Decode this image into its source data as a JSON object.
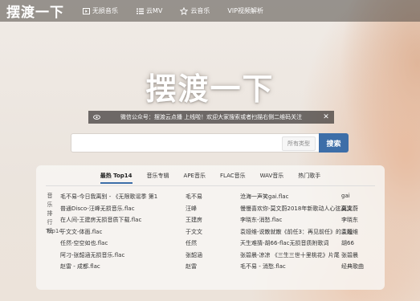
{
  "header": {
    "logo": "摆渡一下",
    "nav": [
      {
        "label": "无损音乐",
        "icon": "video-icon"
      },
      {
        "label": "云MV",
        "icon": "list-icon"
      },
      {
        "label": "云音乐",
        "icon": "star-icon"
      },
      {
        "label": "VIP视频解析",
        "icon": ""
      }
    ]
  },
  "hero": {
    "title": "摆渡一下"
  },
  "notice": {
    "text": "微信公众号：摆渡云点播 上线啦！欢迎大家搜索或者扫描右侧二维码关注"
  },
  "search": {
    "value": "",
    "type_label": "所有类型",
    "button": "搜索"
  },
  "tabs": [
    "最热 Top14",
    "音乐专辑",
    "APE音乐",
    "FLAC音乐",
    "WAV音乐",
    "热门歌手"
  ],
  "side_label": {
    "chars": [
      "音",
      "乐",
      "排",
      "行",
      "榜"
    ],
    "latin": "Top14"
  },
  "rows": [
    [
      "毛不易-今日我离别 - 《无限歌谣季 第1",
      "毛不易",
      "沧海一声笑gai.flac",
      "gai"
    ],
    [
      "普通Disco-汪峰无损音乐.flac",
      "汪峰",
      "慢慢喜欢你-莫文蔚2018年新歌动人心弦高清",
      "莫文蔚"
    ],
    [
      "在人间-王建房无损音质下载.flac",
      "王建房",
      "李晓东-消愁.flac",
      "李晓东"
    ],
    [
      "于文文-体面.flac",
      "于文文",
      "袁娅维-说散就散《前任3：再见前任》的主题",
      "袁娅维"
    ],
    [
      "任然-空空如也.flac",
      "任然",
      "天生难猜-胡66-flac无损音质附歌词",
      "胡66"
    ],
    [
      "阿刁-张韶涵无损音乐.flac",
      "张韶涵",
      "张碧晨-凉凉 《三生三世十里桃花》片尾",
      "张碧晨"
    ],
    [
      "赵雷 - 成都.flac",
      "赵雷",
      "毛不易 - 消愁.flac",
      "经典歌曲"
    ]
  ]
}
